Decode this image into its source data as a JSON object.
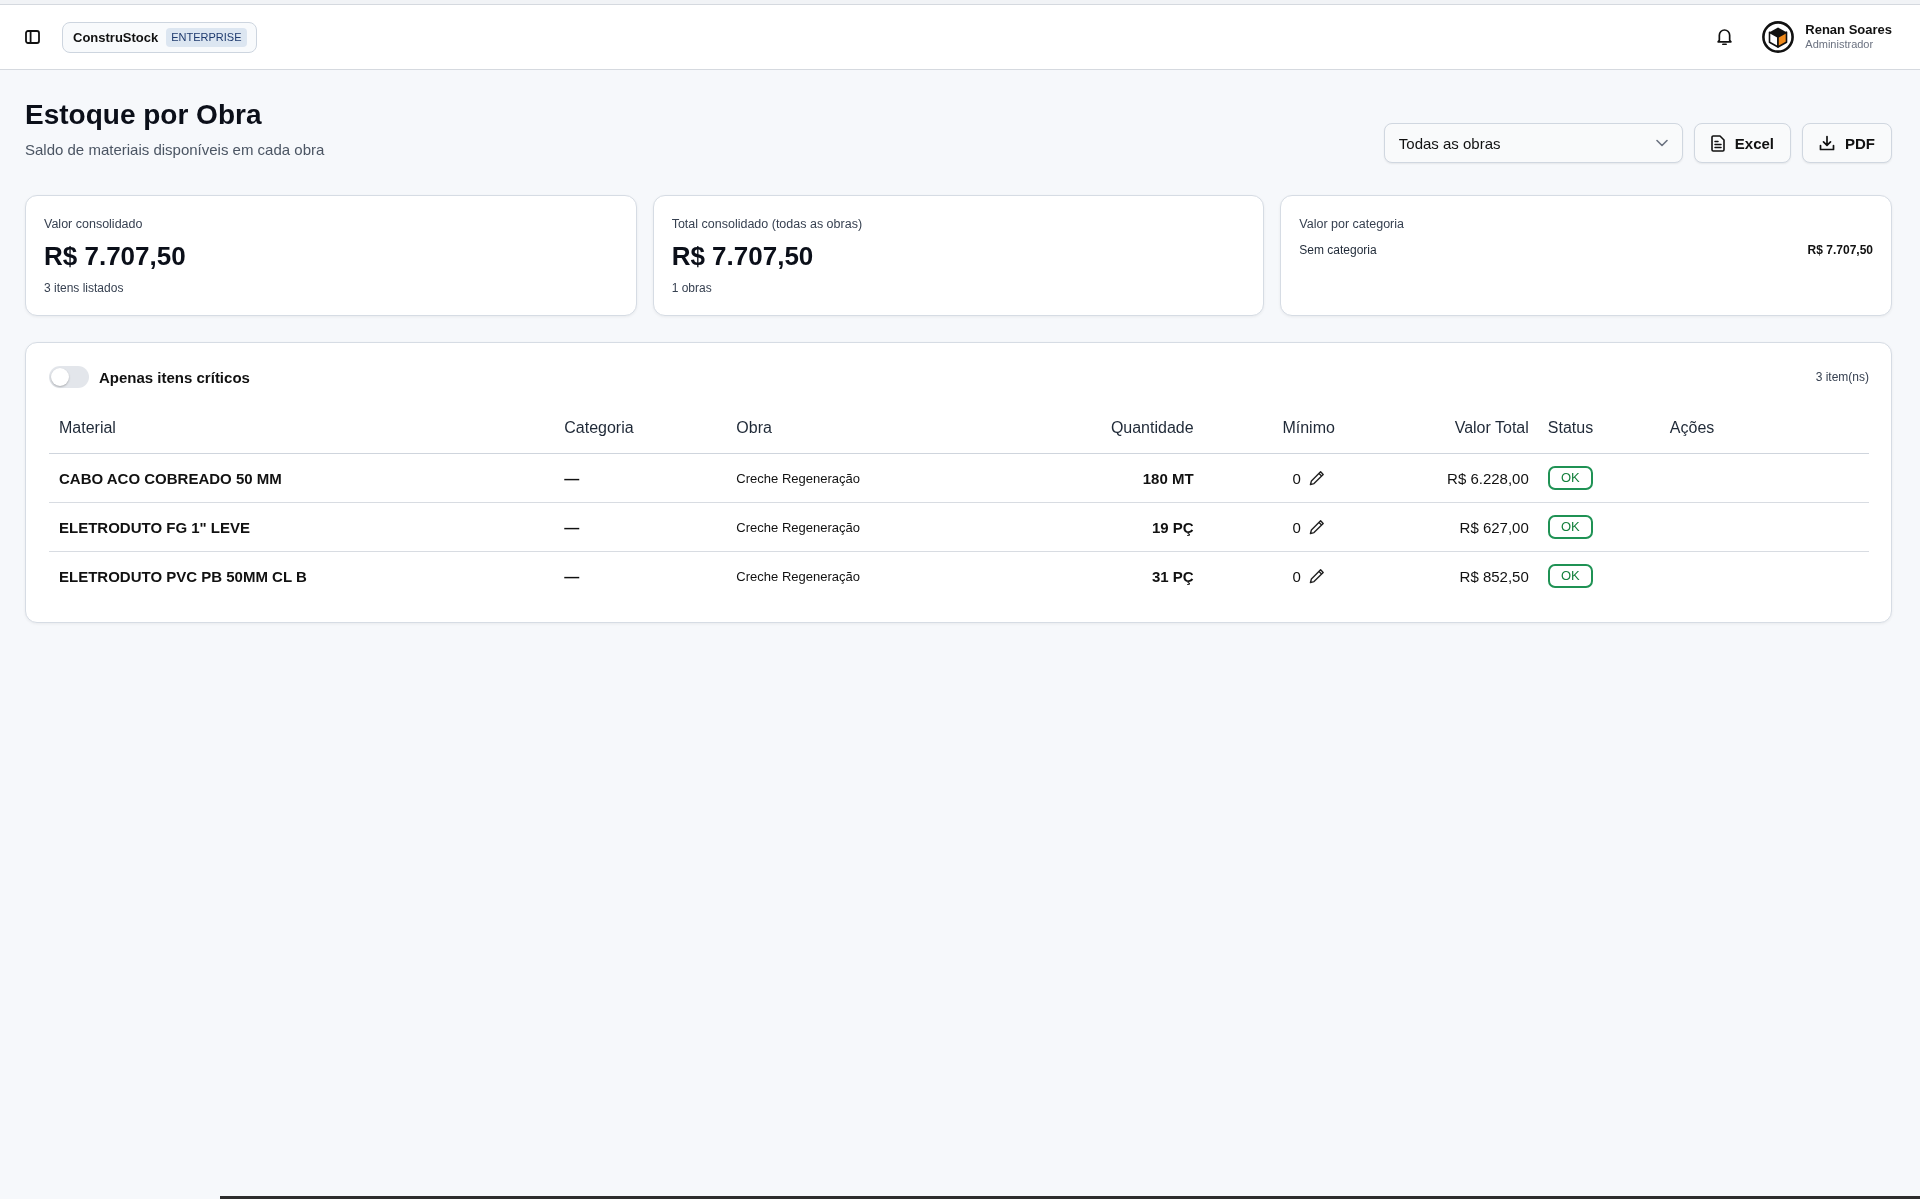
{
  "top_bar": {
    "brand": "ConstruStock",
    "plan_badge": "ENTERPRISE",
    "user": {
      "name": "Renan Soares",
      "role": "Administrador"
    }
  },
  "page": {
    "title": "Estoque por Obra",
    "subtitle": "Saldo de materiais disponíveis em cada obra"
  },
  "actions": {
    "site_select": {
      "value": "Todas as obras"
    },
    "buttons": [
      {
        "label": "Excel",
        "kind": "spreadsheet"
      },
      {
        "label": "PDF",
        "kind": "download"
      }
    ]
  },
  "summary_cards": [
    {
      "kind": "metric",
      "label": "Valor consolidado",
      "value": "R$ 7.707,50",
      "note": "3 itens listados"
    },
    {
      "kind": "metric",
      "label": "Total consolidado (todas as obras)",
      "value": "R$ 7.707,50",
      "note": "1 obras"
    },
    {
      "kind": "breakdown",
      "label": "Valor por categoria",
      "rows": [
        {
          "name": "Sem categoria",
          "value": "R$ 7.707,50"
        }
      ]
    }
  ],
  "table_panel": {
    "critical_toggle": {
      "label": "Apenas itens críticos",
      "on": false
    },
    "count": "3 item(ns)",
    "columns": [
      "Material",
      "Categoria",
      "Obra",
      "Quantidade",
      "Mínimo",
      "Valor Total",
      "Status",
      "Ações"
    ],
    "rows": [
      {
        "material": "CABO ACO COBREADO 50 MM",
        "category": "—",
        "site": "Creche Regeneração",
        "quantity": "180 MT",
        "minimum": "0",
        "total_value": "R$ 6.228,00",
        "status": {
          "label": "OK",
          "kind": "ok"
        }
      },
      {
        "material": "ELETRODUTO FG 1\" LEVE",
        "category": "—",
        "site": "Creche Regeneração",
        "quantity": "19 PÇ",
        "minimum": "0",
        "total_value": "R$ 627,00",
        "status": {
          "label": "OK",
          "kind": "ok"
        }
      },
      {
        "material": "ELETRODUTO PVC PB 50MM CL B",
        "category": "—",
        "site": "Creche Regeneração",
        "quantity": "31 PÇ",
        "minimum": "0",
        "total_value": "R$ 852,50",
        "status": {
          "label": "OK",
          "kind": "ok"
        }
      }
    ]
  }
}
